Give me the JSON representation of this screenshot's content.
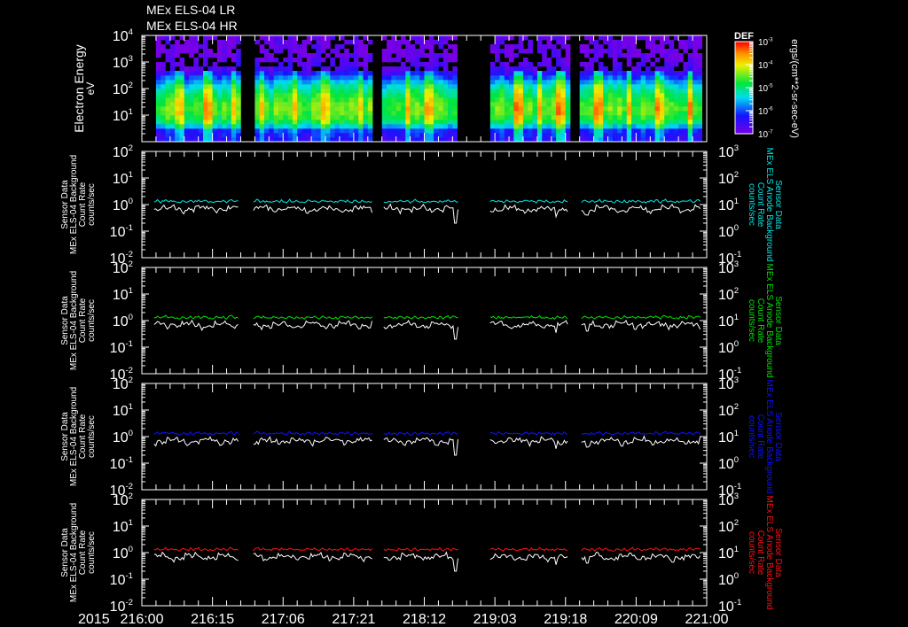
{
  "titles": [
    "MEx ELS-04 LR",
    "MEx ELS-04 HR"
  ],
  "chart_data": {
    "type": "heatmap+line",
    "x_axis": {
      "year_label": "2015",
      "range_hours": [
        0,
        120
      ],
      "tick_labels": [
        "216:00",
        "216:15",
        "217:06",
        "217:21",
        "218:12",
        "219:03",
        "219:18",
        "220:09",
        "221:00"
      ],
      "tick_step_hours": 15,
      "minor_step_hours": 3
    },
    "data_segments_hours": [
      [
        2.6,
        20.7
      ],
      [
        23.7,
        49.0
      ],
      [
        51.4,
        67.2
      ],
      [
        74.0,
        90.6
      ],
      [
        93.4,
        118.6
      ]
    ],
    "spectrogram": {
      "ylabel": "Electron Energy",
      "yunit": "eV",
      "ylog_range": [
        0,
        4
      ],
      "ytick_labels": [
        {
          "b": "10",
          "e": "4"
        },
        {
          "b": "10",
          "e": "3"
        },
        {
          "b": "10",
          "e": "2"
        },
        {
          "b": "10",
          "e": "1"
        }
      ],
      "colorbar": {
        "title": "DEF",
        "unit": "ergs/(cm**2-sr-sec-eV)",
        "log_range": [
          -7,
          -3
        ],
        "tick_labels": [
          {
            "b": "10",
            "e": "-3"
          },
          {
            "b": "10",
            "e": "-4"
          },
          {
            "b": "10",
            "e": "-5"
          },
          {
            "b": "10",
            "e": "-6"
          },
          {
            "b": "10",
            "e": "-7"
          }
        ]
      },
      "energy_profile_logE": [
        0.0,
        0.4,
        0.55,
        0.7,
        1.0,
        1.3,
        1.6,
        1.9,
        2.1,
        2.35,
        2.55,
        2.8,
        3.2,
        3.6,
        4.0
      ],
      "energy_profile_logDEF": [
        -6.4,
        -6.2,
        -5.6,
        -5.0,
        -4.6,
        -4.5,
        -4.7,
        -5.0,
        -5.3,
        -5.8,
        -6.3,
        -6.7,
        -6.9,
        -6.9,
        -6.9
      ],
      "spike_hours": [
        7.5,
        13.5,
        18.8,
        25.0,
        32.0,
        38.5,
        46.0,
        56.0,
        60.5,
        79.5,
        84.0,
        88.5,
        96.5,
        103.0,
        109.5,
        116.0
      ]
    },
    "line_panels": [
      {
        "color": "#00e5e5",
        "left_label": [
          "Sensor Data",
          "MEx ELS-04 Background",
          "Count Rate",
          "counts/sec"
        ],
        "right_label": [
          "Sensor Data",
          "MEx ELS Anode Background",
          "Count Rate",
          "counts/sec"
        ]
      },
      {
        "color": "#00e000",
        "left_label": [
          "Sensor Data",
          "MEx ELS-04 Background",
          "Count Rate",
          "counts/sec"
        ],
        "right_label": [
          "Sensor Data",
          "MEx ELS Anode Background",
          "Count Rate",
          "counts/sec"
        ]
      },
      {
        "color": "#1010ff",
        "left_label": [
          "Sensor Data",
          "MEx ELS-04 Background",
          "Count Rate",
          "counts/sec"
        ],
        "right_label": [
          "Sensor Data",
          "MEx ELS Anode Background",
          "Count Rate",
          "counts/sec"
        ]
      },
      {
        "color": "#ff1010",
        "left_label": [
          "Sensor Data",
          "MEx ELS-04 Background",
          "Count Rate",
          "counts/sec"
        ],
        "right_label": [
          "Sensor Data",
          "MEx ELS Anode Background",
          "Count Rate",
          "counts/sec"
        ]
      }
    ],
    "left_ylog_range": [
      -2,
      2
    ],
    "left_ytick_labels": [
      {
        "b": "10",
        "e": "2"
      },
      {
        "b": "10",
        "e": "1"
      },
      {
        "b": "10",
        "e": "0"
      },
      {
        "b": "10",
        "e": "-1"
      },
      {
        "b": "10",
        "e": "-2"
      }
    ],
    "right_ylog_range": [
      -1,
      3
    ],
    "right_ytick_labels": [
      {
        "b": "10",
        "e": "3"
      },
      {
        "b": "10",
        "e": "2"
      },
      {
        "b": "10",
        "e": "1"
      },
      {
        "b": "10",
        "e": "0"
      },
      {
        "b": "10",
        "e": "-1"
      }
    ],
    "anode_background_values": [
      1.25,
      1.3,
      1.2,
      1.35,
      1.4,
      1.3,
      1.25,
      1.45,
      1.3,
      1.2,
      1.35,
      1.5,
      1.3,
      1.25,
      1.4,
      1.3
    ],
    "sensor_values": [
      0.7,
      0.6,
      0.8,
      0.65,
      0.75,
      0.55,
      0.85,
      0.7,
      0.6,
      0.9,
      0.65,
      0.75,
      0.5,
      0.8,
      0.7,
      0.6
    ],
    "sensor_dips": [
      {
        "t": 66.6,
        "v": 0.2
      },
      {
        "t": 88.0,
        "v": 0.35
      },
      {
        "t": 94.5,
        "v": 0.4
      }
    ]
  }
}
